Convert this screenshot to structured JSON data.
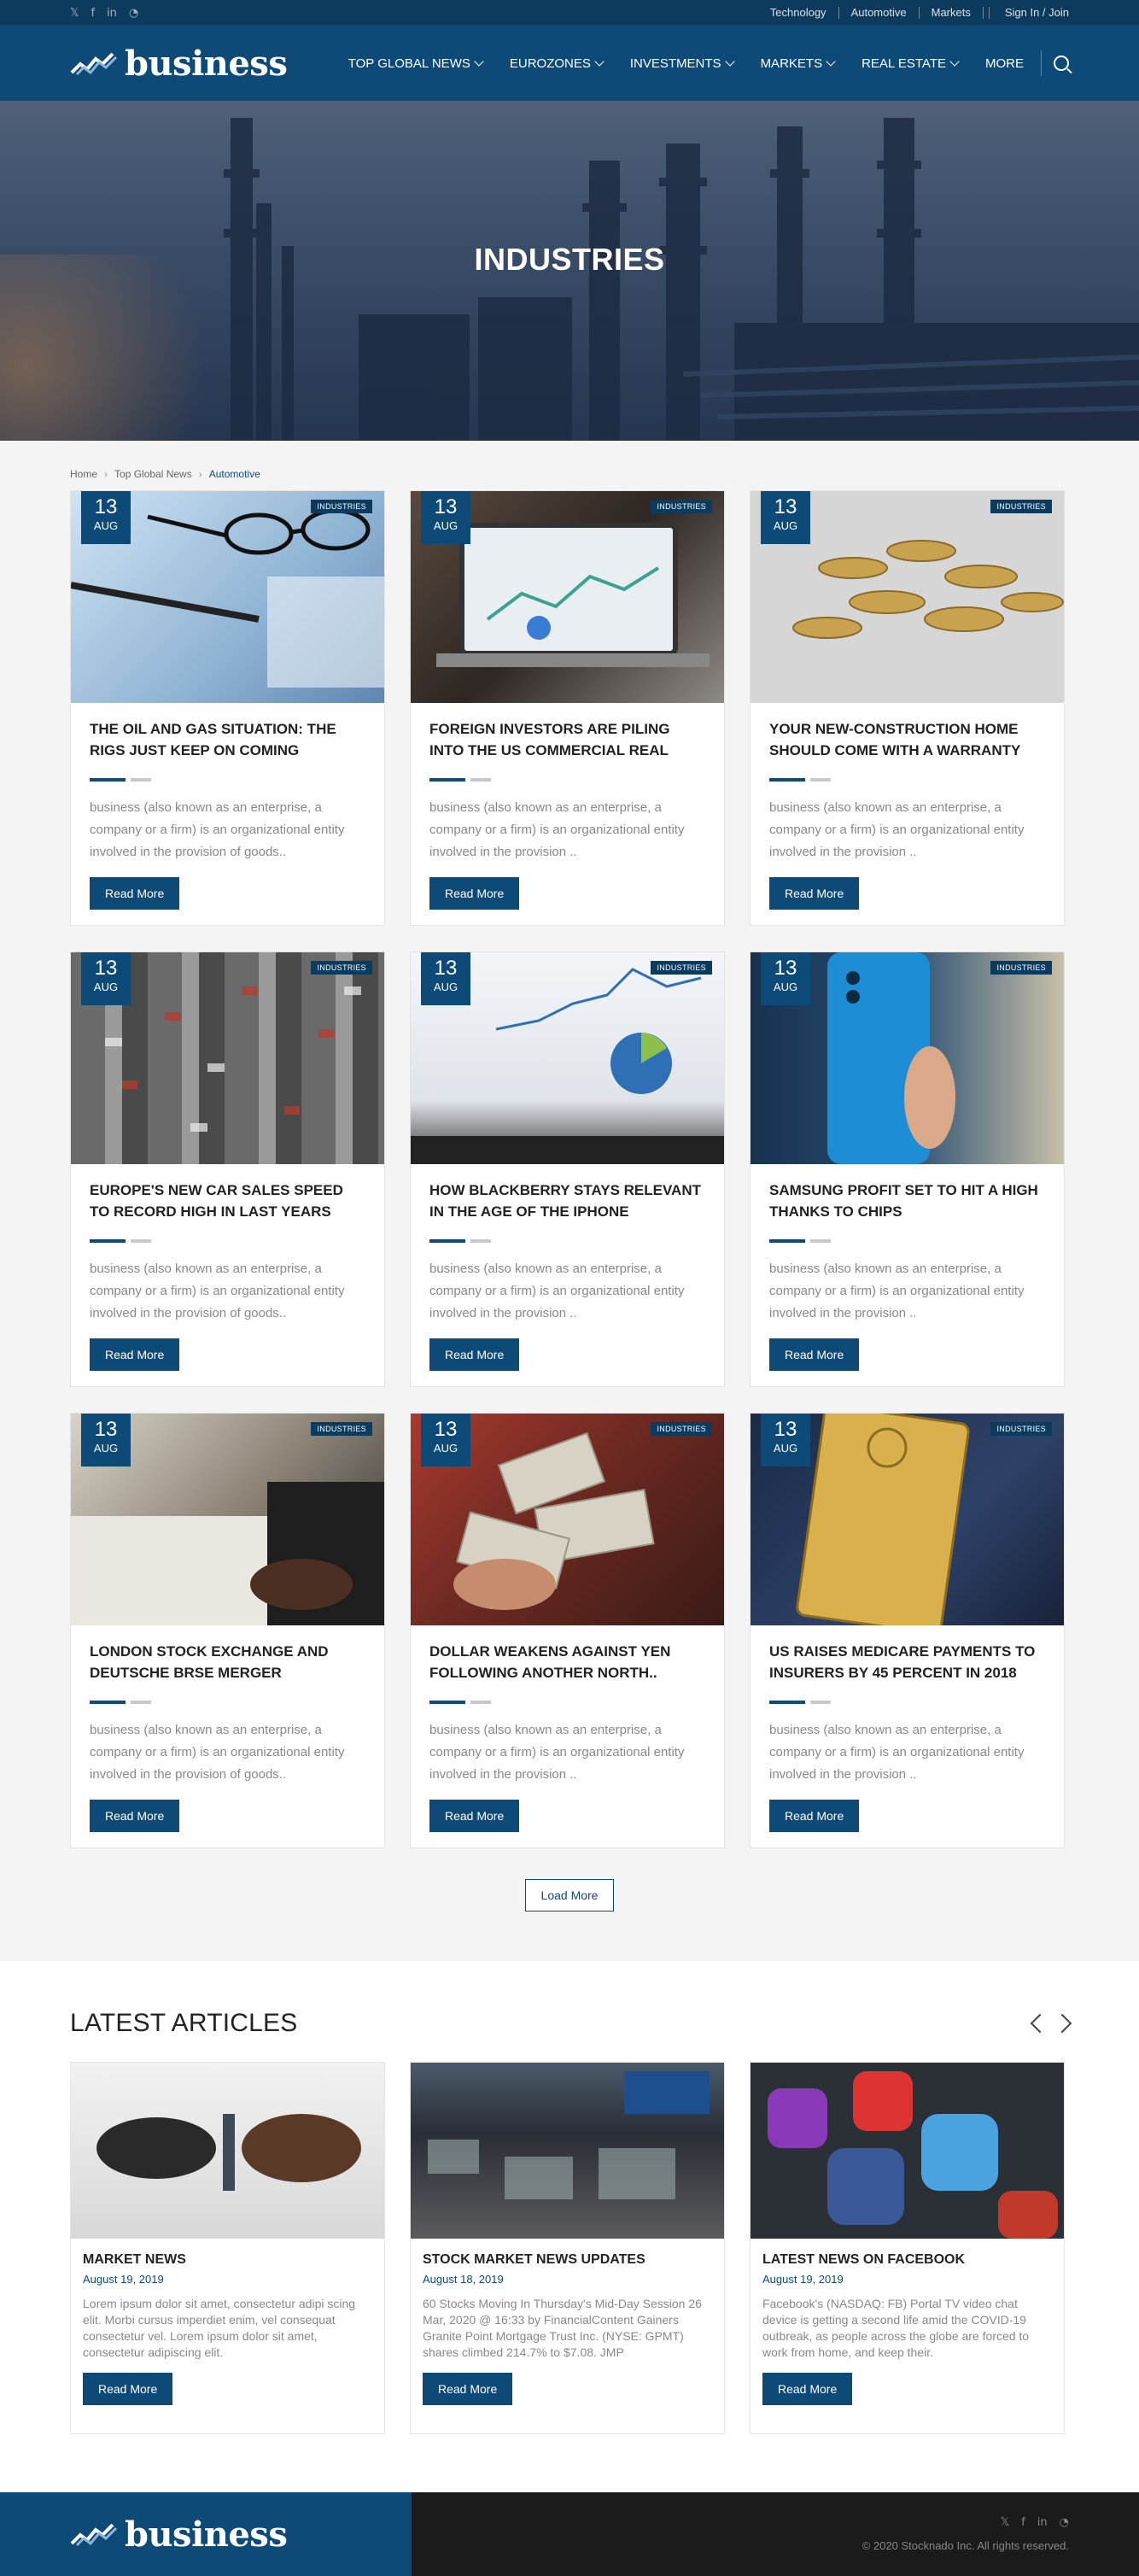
{
  "topbar": {
    "social_icons": [
      "twitter-icon",
      "facebook-icon",
      "linkedin-icon",
      "rss-icon"
    ],
    "links": [
      "Technology",
      "Automotive",
      "Markets"
    ],
    "signin": "Sign In / Join"
  },
  "nav": {
    "logo": "business",
    "items": [
      "TOP GLOBAL NEWS",
      "EUROZONES",
      "INVESTMENTS",
      "MARKETS",
      "REAL ESTATE",
      "MORE"
    ]
  },
  "hero": {
    "title": "INDUSTRIES"
  },
  "breadcrumb": {
    "home": "Home",
    "section": "Top Global News",
    "current": "Automotive"
  },
  "cards": [
    {
      "day": "13",
      "mon": "AUG",
      "tag": "INDUSTRIES",
      "title": "THE OIL AND GAS SITUATION: THE RIGS JUST KEEP ON COMING",
      "text": "business (also known as an enterprise, a company or a firm) is an organizational entity involved in the provision of goods..",
      "btn": "Read More"
    },
    {
      "day": "13",
      "mon": "AUG",
      "tag": "INDUSTRIES",
      "title": "FOREIGN INVESTORS ARE PILING INTO THE US COMMERCIAL REAL ESTATE",
      "text": "business (also known as an enterprise, a company or a firm) is an organizational entity involved in the provision ..",
      "btn": "Read More"
    },
    {
      "day": "13",
      "mon": "AUG",
      "tag": "INDUSTRIES",
      "title": "YOUR NEW-CONSTRUCTION HOME SHOULD COME WITH A WARRANTY",
      "text": "business (also known as an enterprise, a company or a firm) is an organizational entity involved in the provision ..",
      "btn": "Read More"
    },
    {
      "day": "13",
      "mon": "AUG",
      "tag": "INDUSTRIES",
      "title": "EUROPE'S NEW CAR SALES SPEED TO RECORD HIGH IN LAST YEARS",
      "text": "business (also known as an enterprise, a company or a firm) is an organizational entity involved in the provision of goods..",
      "btn": "Read More"
    },
    {
      "day": "13",
      "mon": "AUG",
      "tag": "INDUSTRIES",
      "title": "HOW BLACKBERRY STAYS RELEVANT IN THE AGE OF THE IPHONE",
      "text": "business (also known as an enterprise, a company or a firm) is an organizational entity involved in the provision ..",
      "btn": "Read More"
    },
    {
      "day": "13",
      "mon": "AUG",
      "tag": "INDUSTRIES",
      "title": "SAMSUNG PROFIT SET TO HIT A HIGH THANKS TO CHIPS",
      "text": "business (also known as an enterprise, a company or a firm) is an organizational entity involved in the provision ..",
      "btn": "Read More"
    },
    {
      "day": "13",
      "mon": "AUG",
      "tag": "INDUSTRIES",
      "title": "LONDON STOCK EXCHANGE AND DEUTSCHE BRSE MERGER BLOCKED..",
      "text": "business (also known as an enterprise, a company or a firm) is an organizational entity involved in the provision of goods..",
      "btn": "Read More"
    },
    {
      "day": "13",
      "mon": "AUG",
      "tag": "INDUSTRIES",
      "title": "DOLLAR WEAKENS AGAINST YEN FOLLOWING ANOTHER NORTH..",
      "text": "business (also known as an enterprise, a company or a firm) is an organizational entity involved in the provision ..",
      "btn": "Read More"
    },
    {
      "day": "13",
      "mon": "AUG",
      "tag": "INDUSTRIES",
      "title": "US RAISES MEDICARE PAYMENTS TO INSURERS BY 45 PERCENT IN 2018",
      "text": "business (also known as an enterprise, a company or a firm) is an organizational entity involved in the provision ..",
      "btn": "Read More"
    }
  ],
  "load_more": "Load More",
  "latest": {
    "title": "LATEST ARTICLES",
    "items": [
      {
        "title": "MARKET NEWS",
        "date": "August 19, 2019",
        "text": "Lorem ipsum dolor sit amet, consectetur adipi scing elit. Morbi cursus imperdiet enim, vel consequat consectetur vel. Lorem ipsum dolor sit amet, consectetur adipiscing elit.",
        "btn": "Read More"
      },
      {
        "title": "STOCK MARKET NEWS UPDATES",
        "date": "August 18, 2019",
        "text": "60 Stocks Moving In Thursday's Mid-Day Session 26 Mar, 2020 @ 16:33 by FinancialContent Gainers Granite Point Mortgage Trust Inc. (NYSE: GPMT) shares climbed 214.7% to $7.08. JMP",
        "btn": "Read More"
      },
      {
        "title": "LATEST NEWS ON FACEBOOK",
        "date": "August 19, 2019",
        "text": "Facebook's (NASDAQ: FB) Portal TV video chat device is getting a second life amid the COVID-19 outbreak, as people across the globe are forced to work from home, and keep their.",
        "btn": "Read More"
      }
    ]
  },
  "footer": {
    "logo": "business",
    "copyright": "© 2020 Stocknado Inc. All rights reserved."
  },
  "colors": {
    "primary": "#0d4a78",
    "topbar": "#0d3b5e",
    "footer_dark": "#1b1b1b"
  }
}
